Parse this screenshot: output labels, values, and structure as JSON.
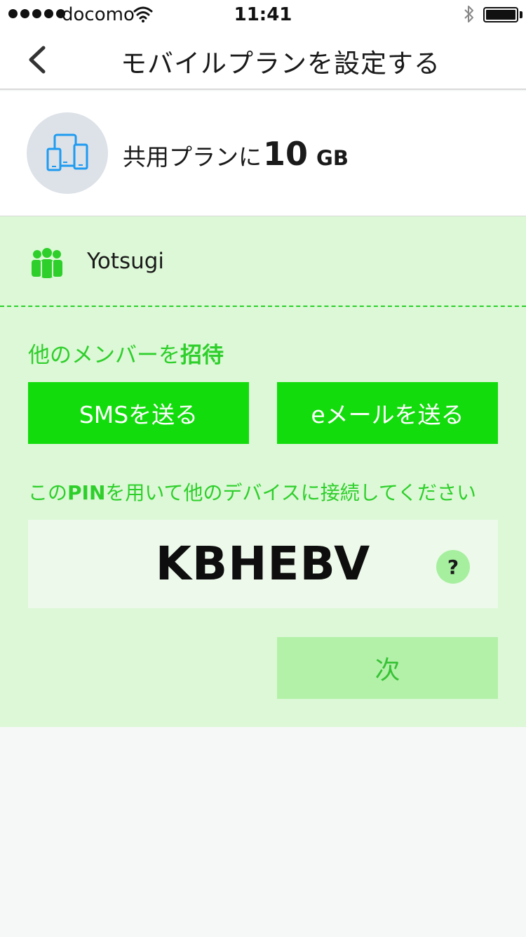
{
  "status_bar": {
    "carrier": "docomo",
    "time": "11:41",
    "battery_level": 1.0
  },
  "nav": {
    "title": "モバイルプランを設定する"
  },
  "plan": {
    "prefix": "共用プランに",
    "amount": "10",
    "unit": "GB"
  },
  "member": {
    "name": "Yotsugi"
  },
  "invite": {
    "title_prefix": "他のメンバーを",
    "title_emphasis": "招待",
    "sms_button": "SMSを送る",
    "email_button": "eメールを送る"
  },
  "pin": {
    "label_prefix": "この",
    "label_emphasis": "PIN",
    "label_suffix": "を用いて他のデバイスに接続してください",
    "code": "KBHEBV",
    "help_symbol": "?"
  },
  "next_button": "次",
  "colors": {
    "accent_green": "#12dc0c",
    "panel_bg": "#dcf8d6",
    "text_green": "#2ecf2b",
    "next_bg": "#b3f1a9",
    "icon_blue": "#1e9bf0"
  }
}
